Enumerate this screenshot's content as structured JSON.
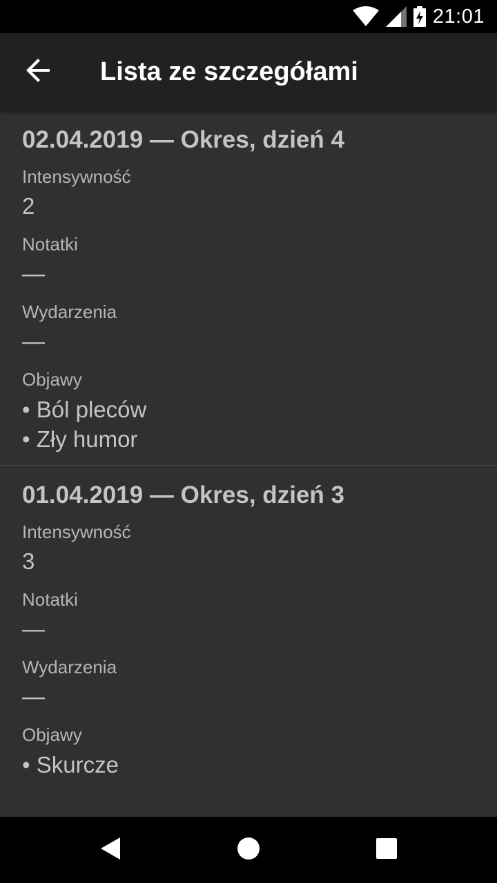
{
  "status_bar": {
    "time": "21:01",
    "icons": [
      "wifi-icon",
      "signal-icon",
      "battery-charging-icon"
    ]
  },
  "app_bar": {
    "title": "Lista ze szczegółami",
    "back_icon": "arrow-back-icon"
  },
  "entries": [
    {
      "title": "02.04.2019 — Okres, dzień 4",
      "intensity_label": "Intensywność",
      "intensity_value": "2",
      "notes_label": "Notatki",
      "notes_value": "—",
      "events_label": "Wydarzenia",
      "events_value": "—",
      "symptoms_label": "Objawy",
      "symptoms": [
        "• Ból pleców",
        "• Zły humor"
      ]
    },
    {
      "title": "01.04.2019 — Okres, dzień 3",
      "intensity_label": "Intensywność",
      "intensity_value": "3",
      "notes_label": "Notatki",
      "notes_value": "—",
      "events_label": "Wydarzenia",
      "events_value": "—",
      "symptoms_label": "Objawy",
      "symptoms": [
        "• Skurcze"
      ]
    }
  ],
  "nav_bar": {
    "icons": [
      "back-triangle-icon",
      "home-circle-icon",
      "recents-square-icon"
    ]
  },
  "colors": {
    "background": "#303030",
    "app_bar": "#212121",
    "text": "#c4c4c4",
    "divider": "#4a4a4a"
  }
}
